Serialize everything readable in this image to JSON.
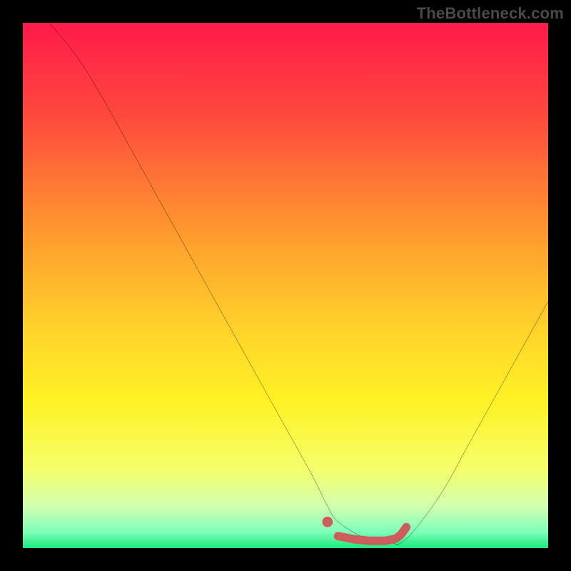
{
  "watermark": "TheBottleneck.com",
  "chart_data": {
    "type": "line",
    "title": "",
    "xlabel": "",
    "ylabel": "",
    "xlim": [
      0,
      100
    ],
    "ylim": [
      0,
      100
    ],
    "grid": false,
    "legend": false,
    "background_gradient": {
      "stops": [
        {
          "pos": 0.0,
          "color": "#ff1a4a"
        },
        {
          "pos": 0.18,
          "color": "#ff4a3d"
        },
        {
          "pos": 0.4,
          "color": "#ff9a2e"
        },
        {
          "pos": 0.58,
          "color": "#ffd22a"
        },
        {
          "pos": 0.72,
          "color": "#fff224"
        },
        {
          "pos": 0.85,
          "color": "#f4ff6a"
        },
        {
          "pos": 0.92,
          "color": "#d2ffb0"
        },
        {
          "pos": 0.97,
          "color": "#7dffb9"
        },
        {
          "pos": 1.0,
          "color": "#19e97c"
        }
      ]
    },
    "series": [
      {
        "name": "bottleneck-curve",
        "color": "#000000",
        "x": [
          5,
          10,
          15,
          20,
          25,
          30,
          35,
          40,
          45,
          50,
          55,
          58,
          60,
          65,
          70,
          72,
          75,
          80,
          85,
          90,
          95,
          100
        ],
        "y": [
          100,
          94,
          86,
          77,
          68,
          59,
          50,
          41,
          32,
          23,
          14,
          8,
          5,
          2,
          1,
          1,
          4,
          11,
          20,
          29,
          38,
          47
        ]
      }
    ],
    "marker": {
      "name": "optimal-range",
      "color": "#cd5c5c",
      "points": [
        {
          "x": 58,
          "y": 5,
          "r": 1.0
        },
        {
          "x": 60,
          "y": 2.3
        },
        {
          "x": 63,
          "y": 1.7
        },
        {
          "x": 66,
          "y": 1.4
        },
        {
          "x": 69,
          "y": 1.4
        },
        {
          "x": 71,
          "y": 1.8
        },
        {
          "x": 72,
          "y": 2.6
        },
        {
          "x": 73,
          "y": 4.0
        }
      ]
    }
  }
}
